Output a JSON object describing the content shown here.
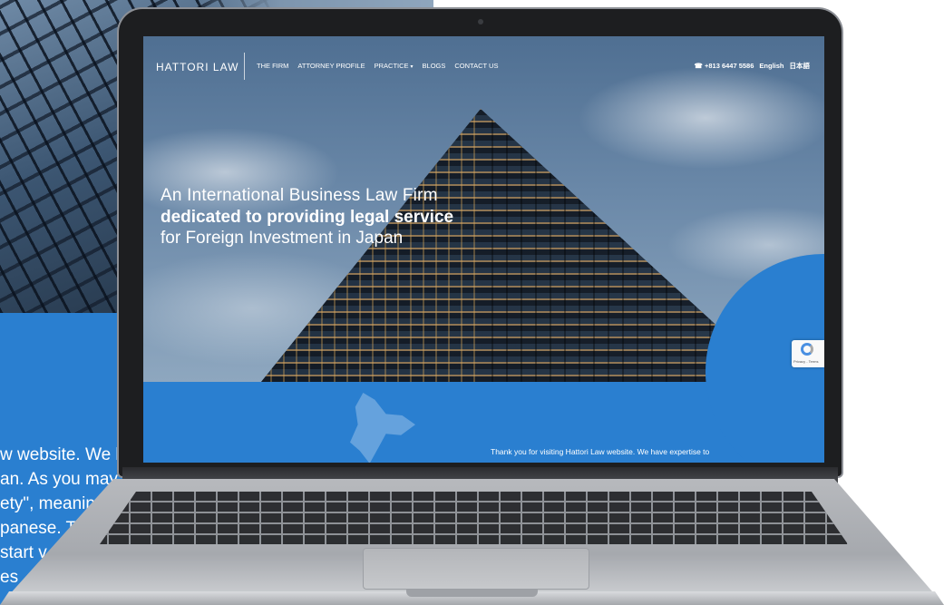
{
  "background_page": {
    "text_lines": [
      "w website. We h",
      "an. As you may l",
      "ety\", meaning",
      "panese. Th",
      "start v",
      "es"
    ]
  },
  "site": {
    "logo": "HATTORI LAW",
    "nav": [
      {
        "label": "THE FIRM"
      },
      {
        "label": "ATTORNEY PROFILE"
      },
      {
        "label": "PRACTICE"
      },
      {
        "label": "BLOGS"
      },
      {
        "label": "CONTACT US"
      }
    ],
    "phone": "☎ +813 6447 5586",
    "languages": [
      "English",
      "日本語"
    ],
    "hero": {
      "line1": "An International Business Law Firm",
      "line2": "dedicated to providing legal service",
      "line3": "for Foreign Investment in Japan"
    },
    "intro": "Thank you for visiting Hattori Law website. We have expertise to",
    "recaptcha": "Privacy - Terms"
  },
  "colors": {
    "brand_blue": "#2a7fd0",
    "text": "#ffffff"
  },
  "icons": {
    "phone": "phone-icon",
    "practice_dropdown": "chevron-down-icon",
    "recaptcha": "recaptcha-icon"
  }
}
